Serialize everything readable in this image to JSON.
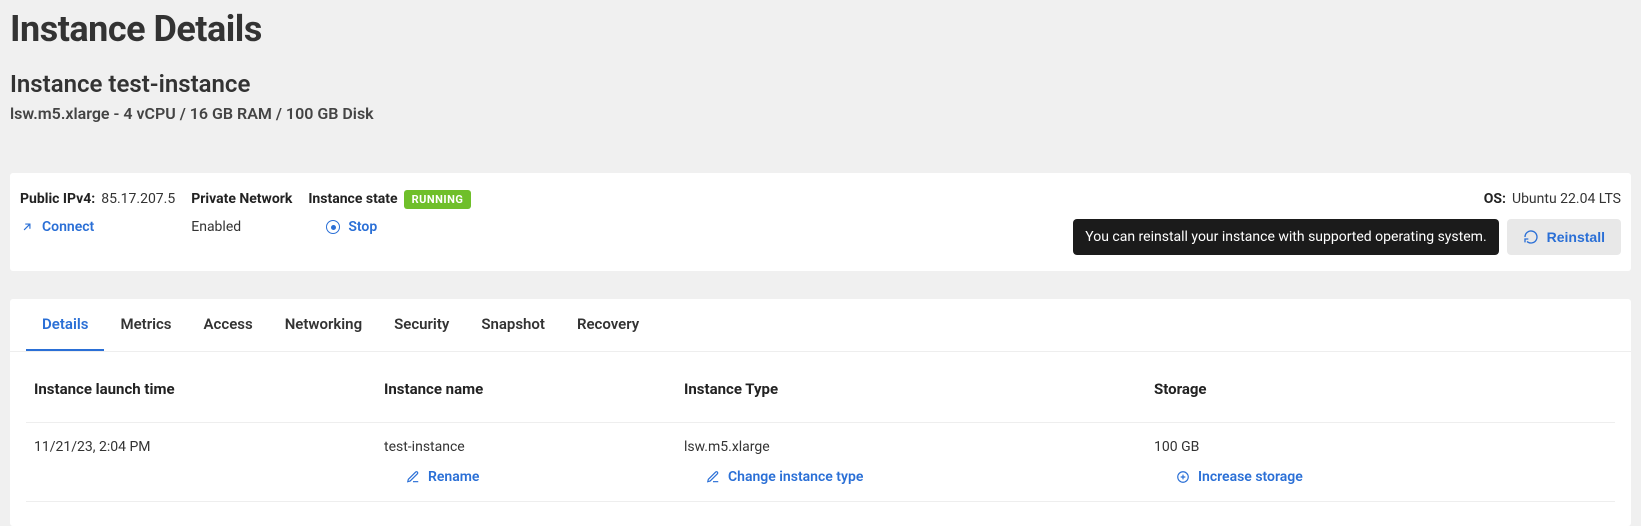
{
  "header": {
    "page_title": "Instance Details",
    "instance_title_prefix": "Instance",
    "instance_name": "test-instance",
    "spec_line": "lsw.m5.xlarge - 4 vCPU / 16 GB RAM / 100 GB Disk"
  },
  "summary": {
    "public_ipv4": {
      "label": "Public IPv4:",
      "value": "85.17.207.5",
      "action": "Connect"
    },
    "private_network": {
      "label": "Private Network",
      "value": "Enabled"
    },
    "state": {
      "label": "Instance state",
      "badge": "RUNNING",
      "action": "Stop"
    },
    "os": {
      "label": "OS:",
      "value": "Ubuntu 22.04 LTS",
      "tooltip": "You can reinstall your instance with supported operating system.",
      "reinstall": "Reinstall"
    }
  },
  "tabs": [
    {
      "label": "Details",
      "active": true
    },
    {
      "label": "Metrics",
      "active": false
    },
    {
      "label": "Access",
      "active": false
    },
    {
      "label": "Networking",
      "active": false
    },
    {
      "label": "Security",
      "active": false
    },
    {
      "label": "Snapshot",
      "active": false
    },
    {
      "label": "Recovery",
      "active": false
    }
  ],
  "details_table": {
    "headers": {
      "launch_time": "Instance launch time",
      "name": "Instance name",
      "type": "Instance Type",
      "storage": "Storage"
    },
    "row": {
      "launch_time": "11/21/23, 2:04 PM",
      "name": "test-instance",
      "type": "lsw.m5.xlarge",
      "storage": "100 GB",
      "actions": {
        "rename": "Rename",
        "change_type": "Change instance type",
        "increase_storage": "Increase storage"
      }
    }
  }
}
